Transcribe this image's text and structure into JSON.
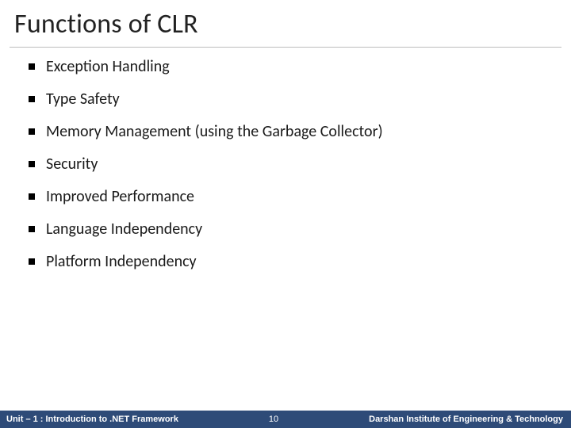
{
  "title": "Functions of CLR",
  "bullets": [
    "Exception Handling",
    "Type Safety",
    "Memory Management (using the Garbage Collector)",
    "Security",
    "Improved Performance",
    "Language Independency",
    "Platform Independency"
  ],
  "footer": {
    "left": "Unit – 1 : Introduction to .NET Framework",
    "page": "10",
    "right": "Darshan Institute of Engineering & Technology"
  }
}
